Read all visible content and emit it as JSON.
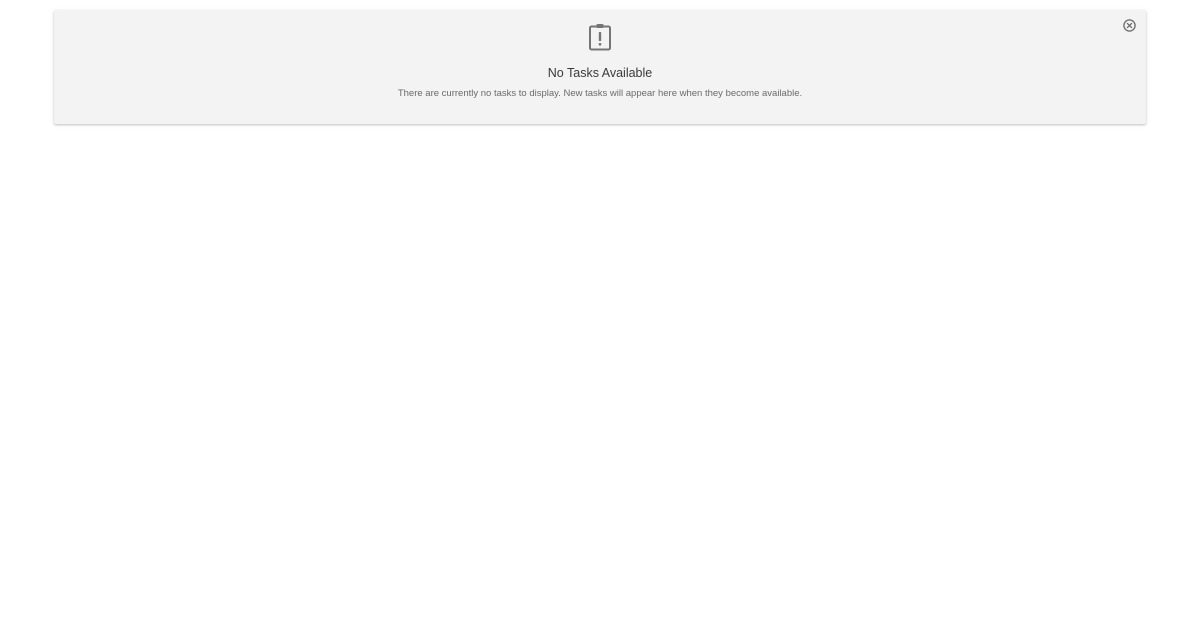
{
  "empty_state": {
    "icon": "clipboard-alert-icon",
    "title": "No Tasks Available",
    "message": "There are currently no tasks to display. New tasks will appear here when they become available."
  },
  "close": {
    "icon": "close-circle-icon"
  },
  "colors": {
    "card_background": "#f3f3f3",
    "page_background": "#ffffff",
    "icon": "#757575",
    "title_text": "#3a3a3a",
    "message_text": "#6b6b6b"
  }
}
